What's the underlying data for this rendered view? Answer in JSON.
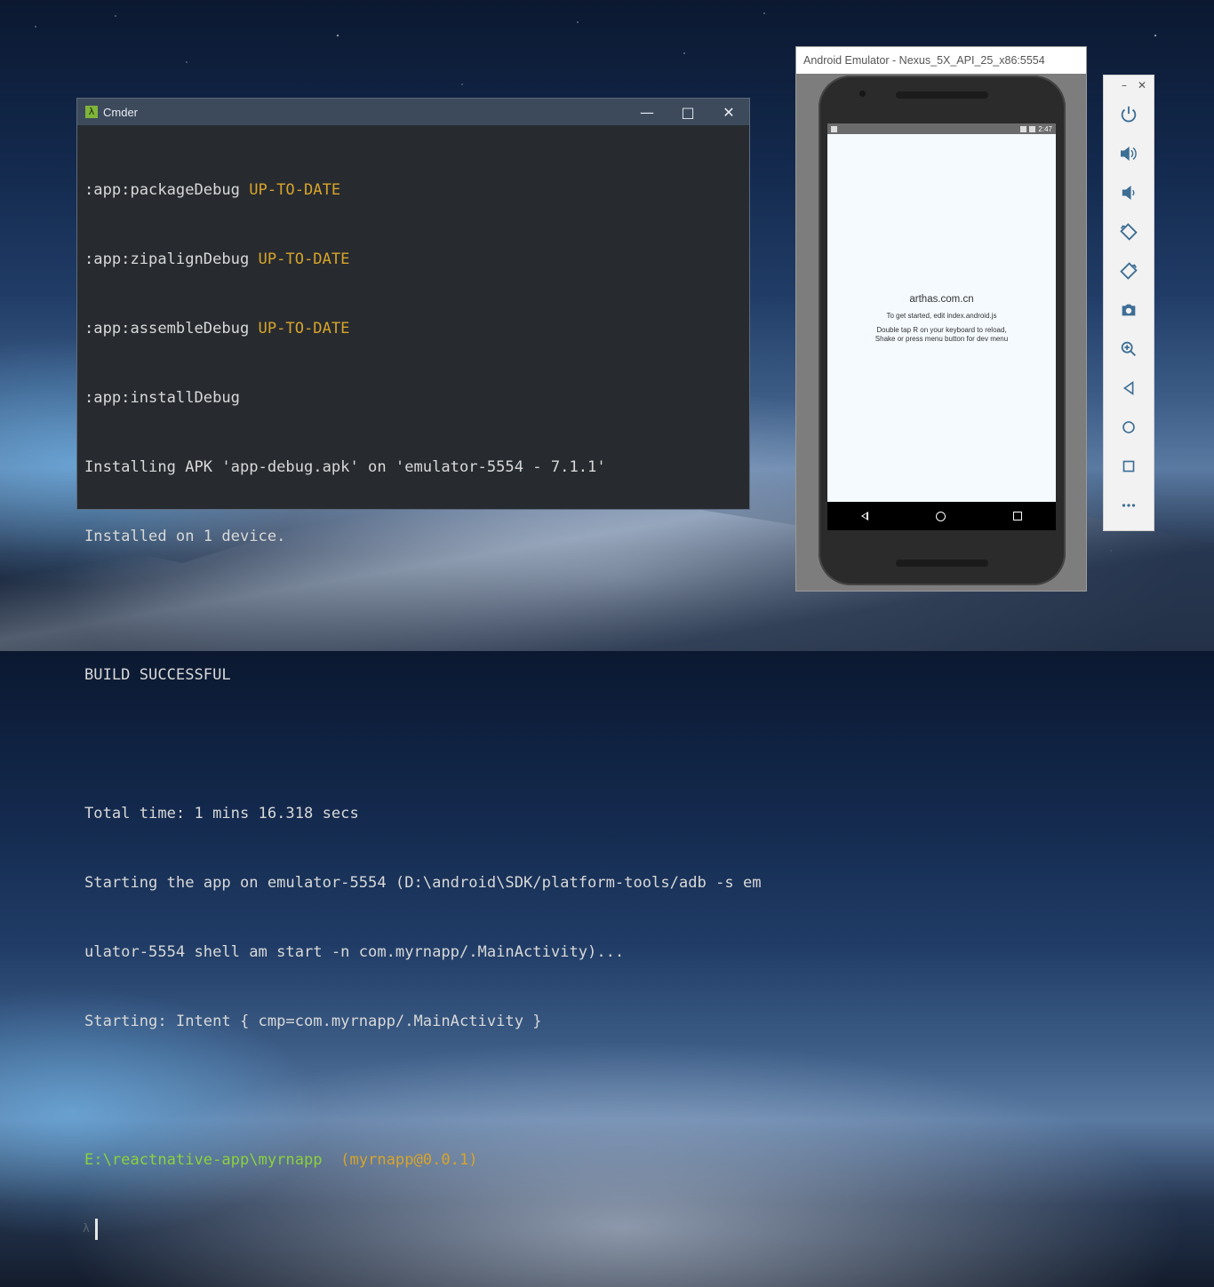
{
  "cmder": {
    "title": "Cmder",
    "lines": [
      {
        "pre": ":app:packageDebug ",
        "status": "UP-TO-DATE"
      },
      {
        "pre": ":app:zipalignDebug ",
        "status": "UP-TO-DATE"
      },
      {
        "pre": ":app:assembleDebug ",
        "status": "UP-TO-DATE"
      },
      {
        "pre": ":app:installDebug",
        "status": ""
      },
      {
        "pre": "Installing APK 'app-debug.apk' on 'emulator-5554 - 7.1.1'",
        "status": ""
      },
      {
        "pre": "Installed on 1 device.",
        "status": ""
      },
      {
        "pre": "",
        "status": ""
      },
      {
        "pre": "BUILD SUCCESSFUL",
        "status": ""
      },
      {
        "pre": "",
        "status": ""
      },
      {
        "pre": "Total time: 1 mins 16.318 secs",
        "status": ""
      },
      {
        "pre": "Starting the app on emulator-5554 (D:\\android\\SDK/platform-tools/adb -s em",
        "status": ""
      },
      {
        "pre": "ulator-5554 shell am start -n com.myrnapp/.MainActivity)...",
        "status": ""
      },
      {
        "pre": "Starting: Intent { cmp=com.myrnapp/.MainActivity }",
        "status": ""
      },
      {
        "pre": "",
        "status": ""
      }
    ],
    "prompt_path": "E:\\reactnative-app\\myrnapp",
    "prompt_pkg": "(myrnapp@0.0.1)",
    "prompt_symbol": "λ"
  },
  "emulator": {
    "title": "Android Emulator - Nexus_5X_API_25_x86:5554",
    "status_time": "2:47",
    "app_title": "arthas.com.cn",
    "app_line1": "To get started, edit index.android.js",
    "app_line2": "Double tap R on your keyboard to reload,",
    "app_line3": "Shake or press menu button for dev menu"
  },
  "toolbar": {
    "tools": [
      "power-icon",
      "volume-up-icon",
      "volume-down-icon",
      "rotate-left-icon",
      "rotate-right-icon",
      "camera-icon",
      "zoom-icon",
      "back-icon",
      "home-icon",
      "overview-icon",
      "more-icon"
    ]
  }
}
